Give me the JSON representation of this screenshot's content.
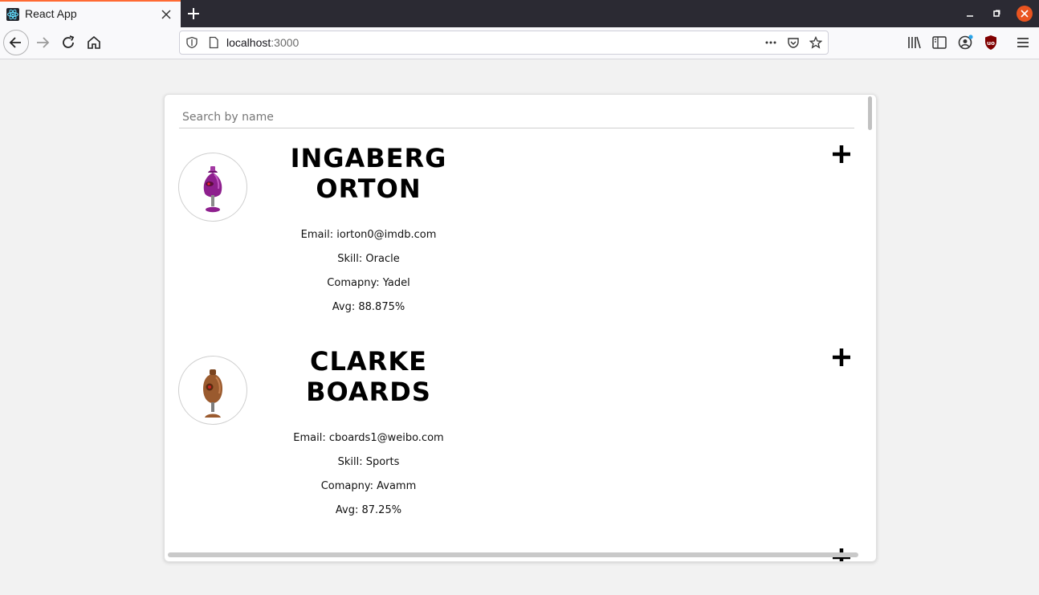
{
  "browser": {
    "tab_title": "React App",
    "url_host": "localhost",
    "url_port": ":3000",
    "accent_color": "#ff6a33"
  },
  "search": {
    "placeholder": "Search by name"
  },
  "students": [
    {
      "first_name": "INGABERG",
      "last_name": "ORTON",
      "email": "Email: iorton0@imdb.com",
      "skill": "Skill: Oracle",
      "company": "Comapny: Yadel",
      "average": "Avg: 88.875%",
      "avatar_icon": "purple-robot-avatar"
    },
    {
      "first_name": "CLARKE",
      "last_name": "BOARDS",
      "email": "Email: cboards1@weibo.com",
      "skill": "Skill: Sports",
      "company": "Comapny: Avamm",
      "average": "Avg: 87.25%",
      "avatar_icon": "brown-robot-avatar"
    }
  ]
}
